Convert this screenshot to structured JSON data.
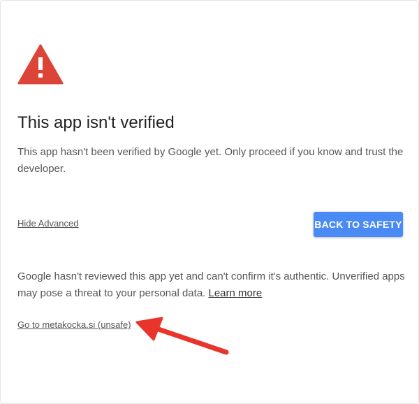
{
  "dialog": {
    "warning_icon": "warning-triangle-icon",
    "title": "This app isn't verified",
    "body": "This app hasn't been verified by Google yet. Only proceed if you know and trust the developer.",
    "hide_advanced_label": "Hide Advanced",
    "back_button_label": "BACK TO SAFETY",
    "advanced_text": "Google hasn't reviewed this app yet and can't confirm it's authentic. Unverified apps may pose a threat to your personal data. ",
    "learn_more_label": "Learn more",
    "go_link_label": "Go to metakocka.si (unsafe)"
  },
  "annotation": {
    "arrow_icon": "red-arrow-icon"
  },
  "colors": {
    "warning": "#db4437",
    "button": "#4a8af4",
    "arrow": "#e8342a"
  }
}
